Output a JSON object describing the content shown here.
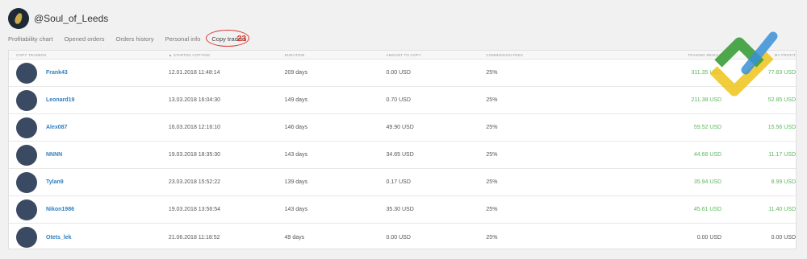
{
  "header": {
    "username": "@Soul_of_Leeds"
  },
  "tabs": [
    {
      "label": "Profitability chart"
    },
    {
      "label": "Opened orders"
    },
    {
      "label": "Orders history"
    },
    {
      "label": "Personal info"
    },
    {
      "label": "Copy traders"
    }
  ],
  "tab_badge": "23",
  "columns": {
    "trader": "COPY TRADERS",
    "started": "▲ STARTED COPYING",
    "duration": "DURATION",
    "amount": "AMOUNT TO COPY",
    "fees": "COMMISSION FEES",
    "result": "TRADING RESULT",
    "profit": "MY PROFIT"
  },
  "rows": [
    {
      "name": "Frank43",
      "date": "12.01.2018 11:48:14",
      "duration": "209 days",
      "amount": "0.00 USD",
      "fee": "25%",
      "result": "311.35 USD",
      "profit": "77.83 USD"
    },
    {
      "name": "Leonard19",
      "date": "13.03.2018 16:04:30",
      "duration": "149 days",
      "amount": "0.70 USD",
      "fee": "25%",
      "result": "211.38 USD",
      "profit": "52.85 USD"
    },
    {
      "name": "Alex087",
      "date": "16.03.2018 12:16:10",
      "duration": "146 days",
      "amount": "49.90 USD",
      "fee": "25%",
      "result": "59.52 USD",
      "profit": "15.56 USD"
    },
    {
      "name": "NNNN",
      "date": "19.03.2018 18:35:30",
      "duration": "143 days",
      "amount": "34.65 USD",
      "fee": "25%",
      "result": "44.68 USD",
      "profit": "11.17 USD"
    },
    {
      "name": "Tylan9",
      "date": "23.03.2018 15:52:22",
      "duration": "139 days",
      "amount": "0.17 USD",
      "fee": "25%",
      "result": "35.94 USD",
      "profit": "8.99 USD"
    },
    {
      "name": "Nikon1986",
      "date": "19.03.2018 13:56:54",
      "duration": "143 days",
      "amount": "35.30 USD",
      "fee": "25%",
      "result": "45.61 USD",
      "profit": "11.40 USD"
    },
    {
      "name": "Otets_lek",
      "date": "21.06.2018 11:18:52",
      "duration": "49 days",
      "amount": "0.00 USD",
      "fee": "25%",
      "result": "0.00 USD",
      "profit": "0.00 USD"
    }
  ],
  "colors": {
    "accent_blue": "#2f7fc1",
    "profit_green": "#5cb85c",
    "highlight_red": "#d9352f"
  }
}
